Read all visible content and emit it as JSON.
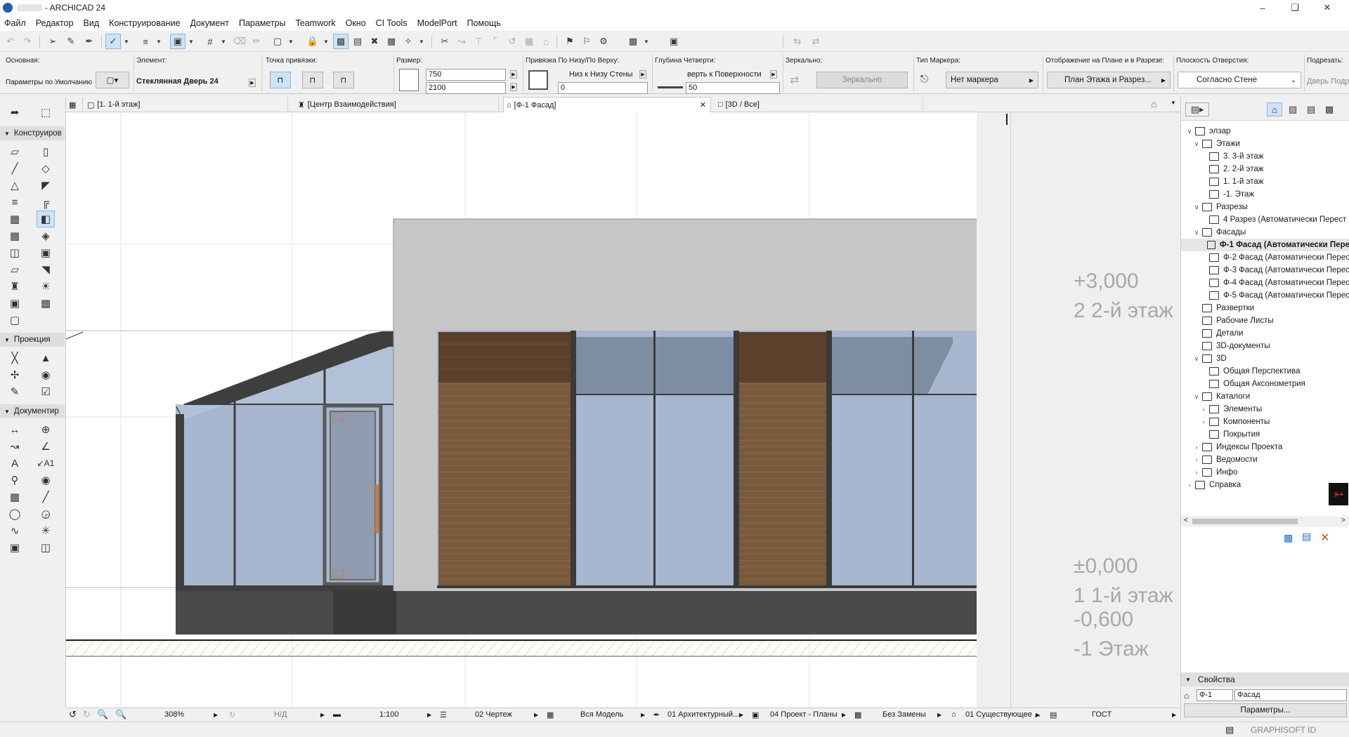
{
  "window": {
    "app_title": "- ARCHICAD 24",
    "controls": [
      "minimize-icon",
      "maximize-icon",
      "close-icon"
    ]
  },
  "menu": [
    "Файл",
    "Редактор",
    "Вид",
    "Конструирование",
    "Документ",
    "Параметры",
    "Teamwork",
    "Окно",
    "CI Tools",
    "ModelPort",
    "Помощь"
  ],
  "infobox": {
    "osnovnaya_label": "Основная:",
    "osnovnaya_value": "Параметры по Умолчанию",
    "element_label": "Элемент:",
    "element_value": "Стеклянная Дверь 24",
    "anchor_label": "Точка привязки:",
    "size_label": "Размер:",
    "width": "750",
    "height": "2100",
    "binding_label": "Привязка По Низу/По Верху:",
    "binding_value": "Низ к Низу Стены",
    "binding_offset": "0",
    "reveal_label": "Глубина Четверти:",
    "reveal_value": "верть к Поверхности",
    "reveal_depth": "50",
    "mirror_label": "Зеркально:",
    "mirror_button": "Зеркально",
    "marker_label": "Тип Маркера:",
    "marker_value": "Нет маркера",
    "display_label": "Отображение на Плане и в Разрезе:",
    "display_value": "План Этажа и Разрез...",
    "plane_label": "Плоскость Отверстия:",
    "plane_value": "Согласно Стене",
    "sign_label": "Подрезать:",
    "sign_value": "Дверь Подр"
  },
  "tabs": [
    {
      "label": "[1. 1-й этаж]",
      "active": false
    },
    {
      "label": "[Центр Взаимодействия]",
      "active": false
    },
    {
      "label": "[Ф-1 Фасад]",
      "active": true
    },
    {
      "label": "[3D / Все]",
      "active": false
    }
  ],
  "toolbox": {
    "sections": [
      "Конструиров",
      "Проекция",
      "Документир"
    ]
  },
  "canvas": {
    "level_labels": [
      {
        "elev": "+3,000",
        "name": "2 2-й этаж"
      },
      {
        "elev": "±0,000",
        "name": "1 1-й этаж"
      },
      {
        "elev": "-0,600",
        "name": "-1 Этаж"
      }
    ],
    "colors": {
      "glass": "#a7b7cf",
      "wood": "#7a5a3d",
      "wall": "#c7c7c7",
      "frame": "#3e3e3e",
      "plinth": "#4a4a4a",
      "ground_hatch": "#c8b24a"
    }
  },
  "navigator": {
    "tree": [
      {
        "label": "элзар",
        "level": 0,
        "chev": "v",
        "bold": false
      },
      {
        "label": "Этажи",
        "level": 1,
        "chev": "v",
        "bold": false
      },
      {
        "label": "3. 3-й этаж",
        "level": 2,
        "chev": "",
        "bold": false
      },
      {
        "label": "2. 2-й этаж",
        "level": 2,
        "chev": "",
        "bold": false
      },
      {
        "label": "1. 1-й этаж",
        "level": 2,
        "chev": "",
        "bold": false
      },
      {
        "label": "-1. Этаж",
        "level": 2,
        "chev": "",
        "bold": false
      },
      {
        "label": "Разрезы",
        "level": 1,
        "chev": "v",
        "bold": false
      },
      {
        "label": "4 Разрез (Автоматически Перест",
        "level": 2,
        "chev": "",
        "bold": false
      },
      {
        "label": "Фасады",
        "level": 1,
        "chev": "v",
        "bold": false
      },
      {
        "label": "Ф-1 Фасад (Автоматически Пере",
        "level": 2,
        "chev": "",
        "bold": true
      },
      {
        "label": "Ф-2 Фасад (Автоматически Перес",
        "level": 2,
        "chev": "",
        "bold": false
      },
      {
        "label": "Ф-3 Фасад (Автоматически Перес",
        "level": 2,
        "chev": "",
        "bold": false
      },
      {
        "label": "Ф-4 Фасад (Автоматически Перес",
        "level": 2,
        "chev": "",
        "bold": false
      },
      {
        "label": "Ф-5 Фасад (Автоматически Перес",
        "level": 2,
        "chev": "",
        "bold": false
      },
      {
        "label": "Развертки",
        "level": 1,
        "chev": "",
        "bold": false
      },
      {
        "label": "Рабочие Листы",
        "level": 1,
        "chev": "",
        "bold": false
      },
      {
        "label": "Детали",
        "level": 1,
        "chev": "",
        "bold": false
      },
      {
        "label": "3D-документы",
        "level": 1,
        "chev": "",
        "bold": false
      },
      {
        "label": "3D",
        "level": 1,
        "chev": "v",
        "bold": false
      },
      {
        "label": "Общая Перспектива",
        "level": 2,
        "chev": "",
        "bold": false
      },
      {
        "label": "Общая Аксонометрия",
        "level": 2,
        "chev": "",
        "bold": false
      },
      {
        "label": "Каталоги",
        "level": 1,
        "chev": "v",
        "bold": false
      },
      {
        "label": "Элементы",
        "level": 2,
        "chev": ">",
        "bold": false
      },
      {
        "label": "Компоненты",
        "level": 2,
        "chev": ">",
        "bold": false
      },
      {
        "label": "Покрытия",
        "level": 2,
        "chev": "",
        "bold": false
      },
      {
        "label": "Индексы Проекта",
        "level": 1,
        "chev": ">",
        "bold": false
      },
      {
        "label": "Ведомости",
        "level": 1,
        "chev": ">",
        "bold": false
      },
      {
        "label": "Инфо",
        "level": 1,
        "chev": ">",
        "bold": false
      },
      {
        "label": "Справка",
        "level": 0,
        "chev": ">",
        "bold": false
      }
    ]
  },
  "properties": {
    "title": "Свойства",
    "id": "Ф-1",
    "name": "Фасад",
    "params_button": "Параметры..."
  },
  "statusbar": {
    "zoom": "308%",
    "angle": "Н/Д",
    "scale": "1:100",
    "layer_combo": "02 Чертеж",
    "model_view": "Вся Модель",
    "pen_set": "01 Архитектурный...",
    "dim_standard": "04 Проект - Планы",
    "override": "Без Замены",
    "renovation": "01 Существующее ...",
    "standard": "ГОСТ"
  },
  "footer": {
    "graphisoft_id": "GRAPHISOFT ID"
  }
}
